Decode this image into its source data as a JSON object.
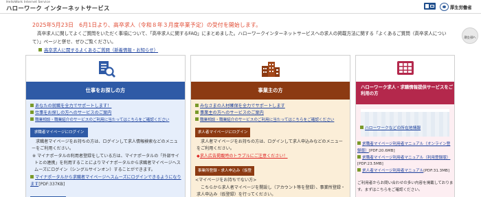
{
  "header": {
    "logo_en": "HelloWork Internet Service",
    "logo_jp": "ハローワーク インターネットサービス",
    "mhlw": "厚生労働省"
  },
  "notice": {
    "title": "2025年5月23日　6月1日より、高卒求人（令和８年３月度卒業予定）の受付を開始します。",
    "body": "高卒求人に関してよくご質問をいただく事項について、「高卒求人に関するFAQ」にまとめました。ハローワークインターネットサービスへの求人の掲載方法に関する「よくあるご質問（高卒求人について）」ページと併せ、ぜひご覧ください。",
    "link": "高卒求人に関するよくあるご質問（新着情報・お知らせ）"
  },
  "page_top": {
    "line1": "ページ",
    "line2": "最上部へ"
  },
  "job": {
    "title": "仕事をお探しの方",
    "links": [
      "あなたの就職を全力でサポートします！",
      "仕事をお探しの方へのサービスのご案内",
      "職業相談・職業紹介のサービスのご利用に当たってはこちらをご確認ください"
    ],
    "btn_mypage": "求職者マイページにログイン",
    "p1": "求職者マイページをお持ちの方は、ログインして求人情報検索などのメニューをご利用ください。",
    "p2": "※ マイナポータルの利用者登録をしている方は、マイナポータルの「外部サイトとの連携」を利用することによりマイナポータルから求職者マイページへスムーズにログイン（シングルサインオン）することができます。",
    "link_mynaportal": "マイナポータルから求職者マイページへスムーズにログインできるようになります",
    "pdf": "[PDF:337KB]"
  },
  "emp": {
    "title": "事業主の方",
    "links": [
      "みなさまの人材確保を全力でサポートします",
      "事業主の方へのサービスのご案内",
      "職業相談・職業紹介のサービスのご利用に当たってはこちらをご確認ください"
    ],
    "btn_mypage": "求人者マイページにログイン",
    "p1": "求人者マイページをお持ちの方は、ログインして求人申込みなどのメニューをご利用ください。",
    "alert": "求人広告掲載時のトラブルにご注意ください！",
    "btn_register": "事業所登録・求人申込み（仮登録）",
    "p2": "<マイページをお持ちでない方>",
    "p3": "こちらから求人者マイページを開設し（アカウント等を登録）、事業所登録・求人申込み（仮登録）を行ってください。"
  },
  "pr": {
    "title": "ハローワーク求人・求職情報提供サービスをご利用の方",
    "link_map": "ハローワークなどの所在地情報",
    "manuals": [
      {
        "label": "求職者マイページ利用者マニュアル（オンライン登録版）",
        "pdf": "[PDF:20.6MB]"
      },
      {
        "label": "求職者マイページ利用者マニュアル（利用登録版）",
        "pdf": "[PDF:23.5MB]"
      },
      {
        "label": "求人者マイページ利用者マニュアル",
        "pdf": "[PDF:31.3MB]"
      }
    ],
    "footer": "ご利用者からお問い合わせの多い内容を掲載しております。まずはこちらをご確認ください。"
  },
  "colors": {
    "job_accent": "#2e5aa6",
    "emp_accent": "#8c3a12",
    "pr_accent": "#b4284c",
    "notice_red": "#e04a32",
    "link_blue": "#1a3f9c",
    "bullet_green": "#7a9a2a"
  },
  "icons": {
    "job": "job-search-document-icon",
    "emp": "office-buildings-icon",
    "pr": "grid-window-icon"
  }
}
